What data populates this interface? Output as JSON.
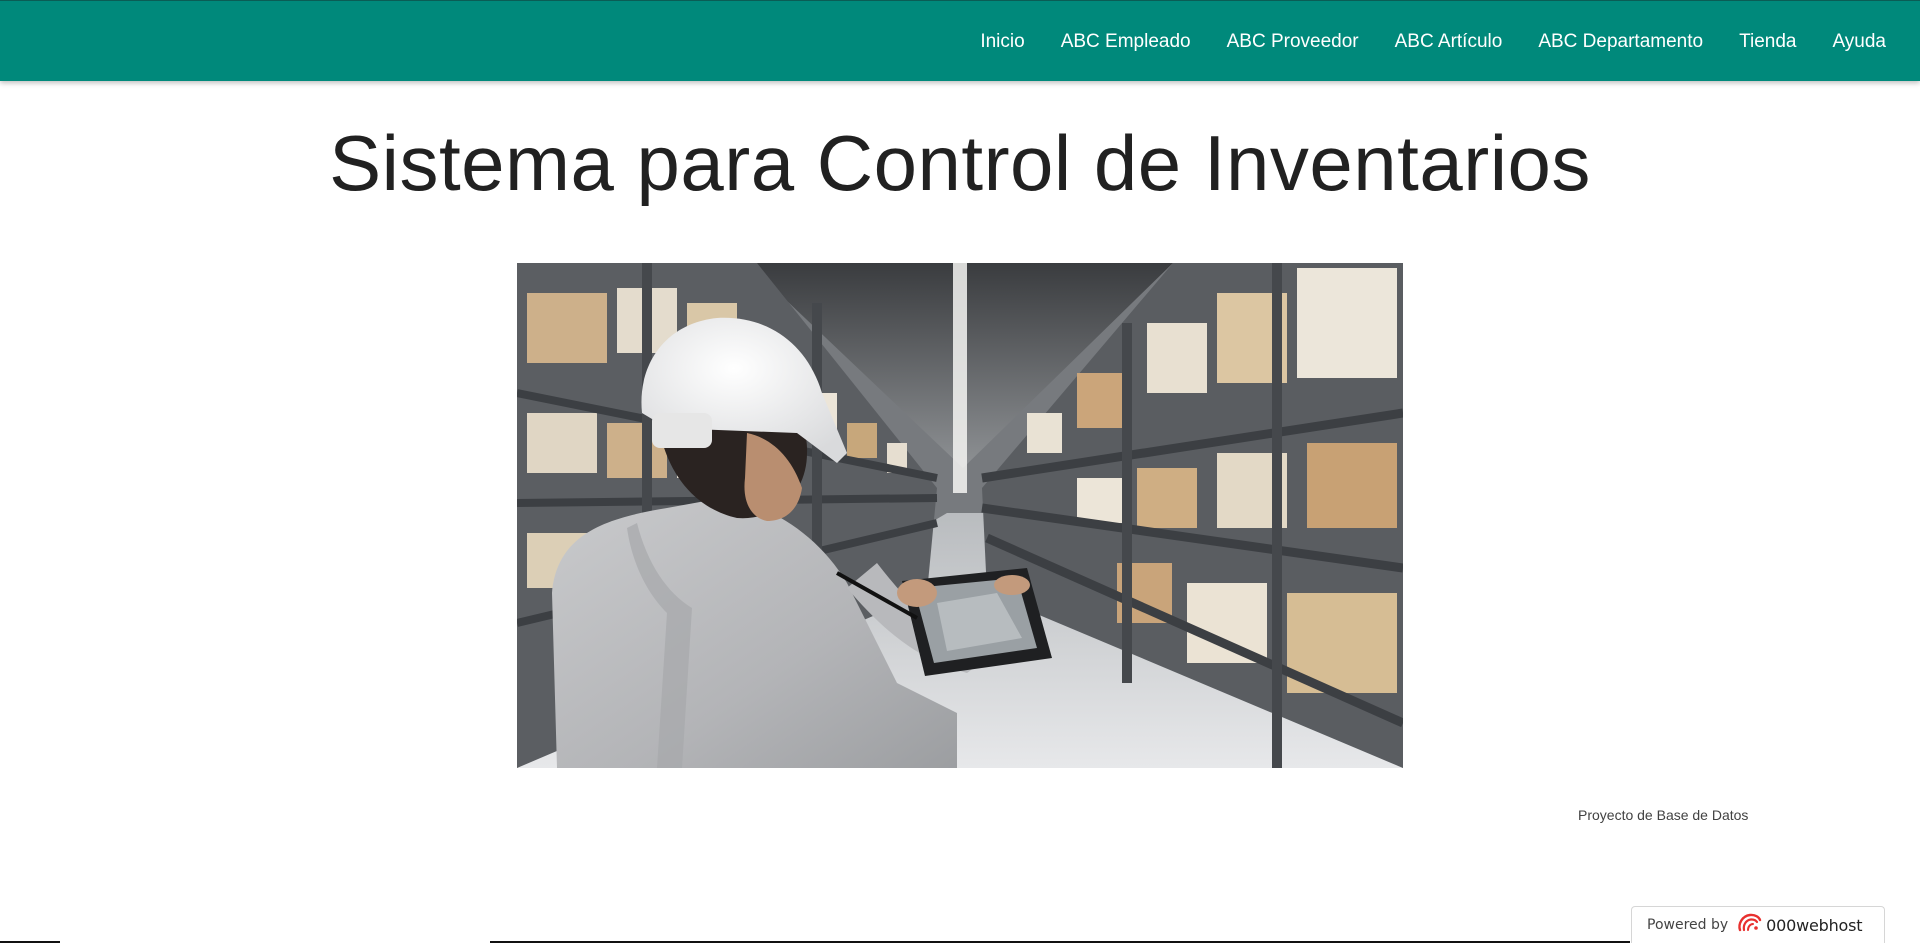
{
  "navbar": {
    "bg_color": "#00897b",
    "items": [
      {
        "label": "Inicio"
      },
      {
        "label": "ABC Empleado"
      },
      {
        "label": "ABC Proveedor"
      },
      {
        "label": "ABC Artículo"
      },
      {
        "label": "ABC Departamento"
      },
      {
        "label": "Tienda"
      },
      {
        "label": "Ayuda"
      }
    ]
  },
  "main": {
    "title": "Sistema para Control de Inventarios",
    "caption": "Proyecto de Base de Datos"
  },
  "footer_badge": {
    "prefix": "Powered by",
    "brand": "000webhost",
    "logo_icon": "000webhost-swirl-icon",
    "logo_color": "#e8312f"
  }
}
